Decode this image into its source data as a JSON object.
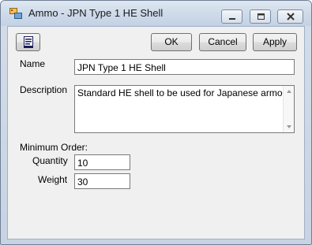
{
  "window": {
    "title": "Ammo - JPN Type 1 HE Shell",
    "app_icon": "app-icon",
    "controls": [
      "minimize-icon",
      "maximize-icon",
      "close-icon"
    ]
  },
  "toolbar": {
    "icon_button": "document-icon",
    "ok_label": "OK",
    "cancel_label": "Cancel",
    "apply_label": "Apply"
  },
  "form": {
    "name_label": "Name",
    "name_value": "JPN Type 1 HE Shell",
    "description_label": "Description",
    "description_value": "Standard HE shell to be used for Japanese armor.",
    "minimum_order_label": "Minimum Order:",
    "quantity_label": "Quantity",
    "quantity_value": "10",
    "weight_label": "Weight",
    "weight_value": "30"
  }
}
